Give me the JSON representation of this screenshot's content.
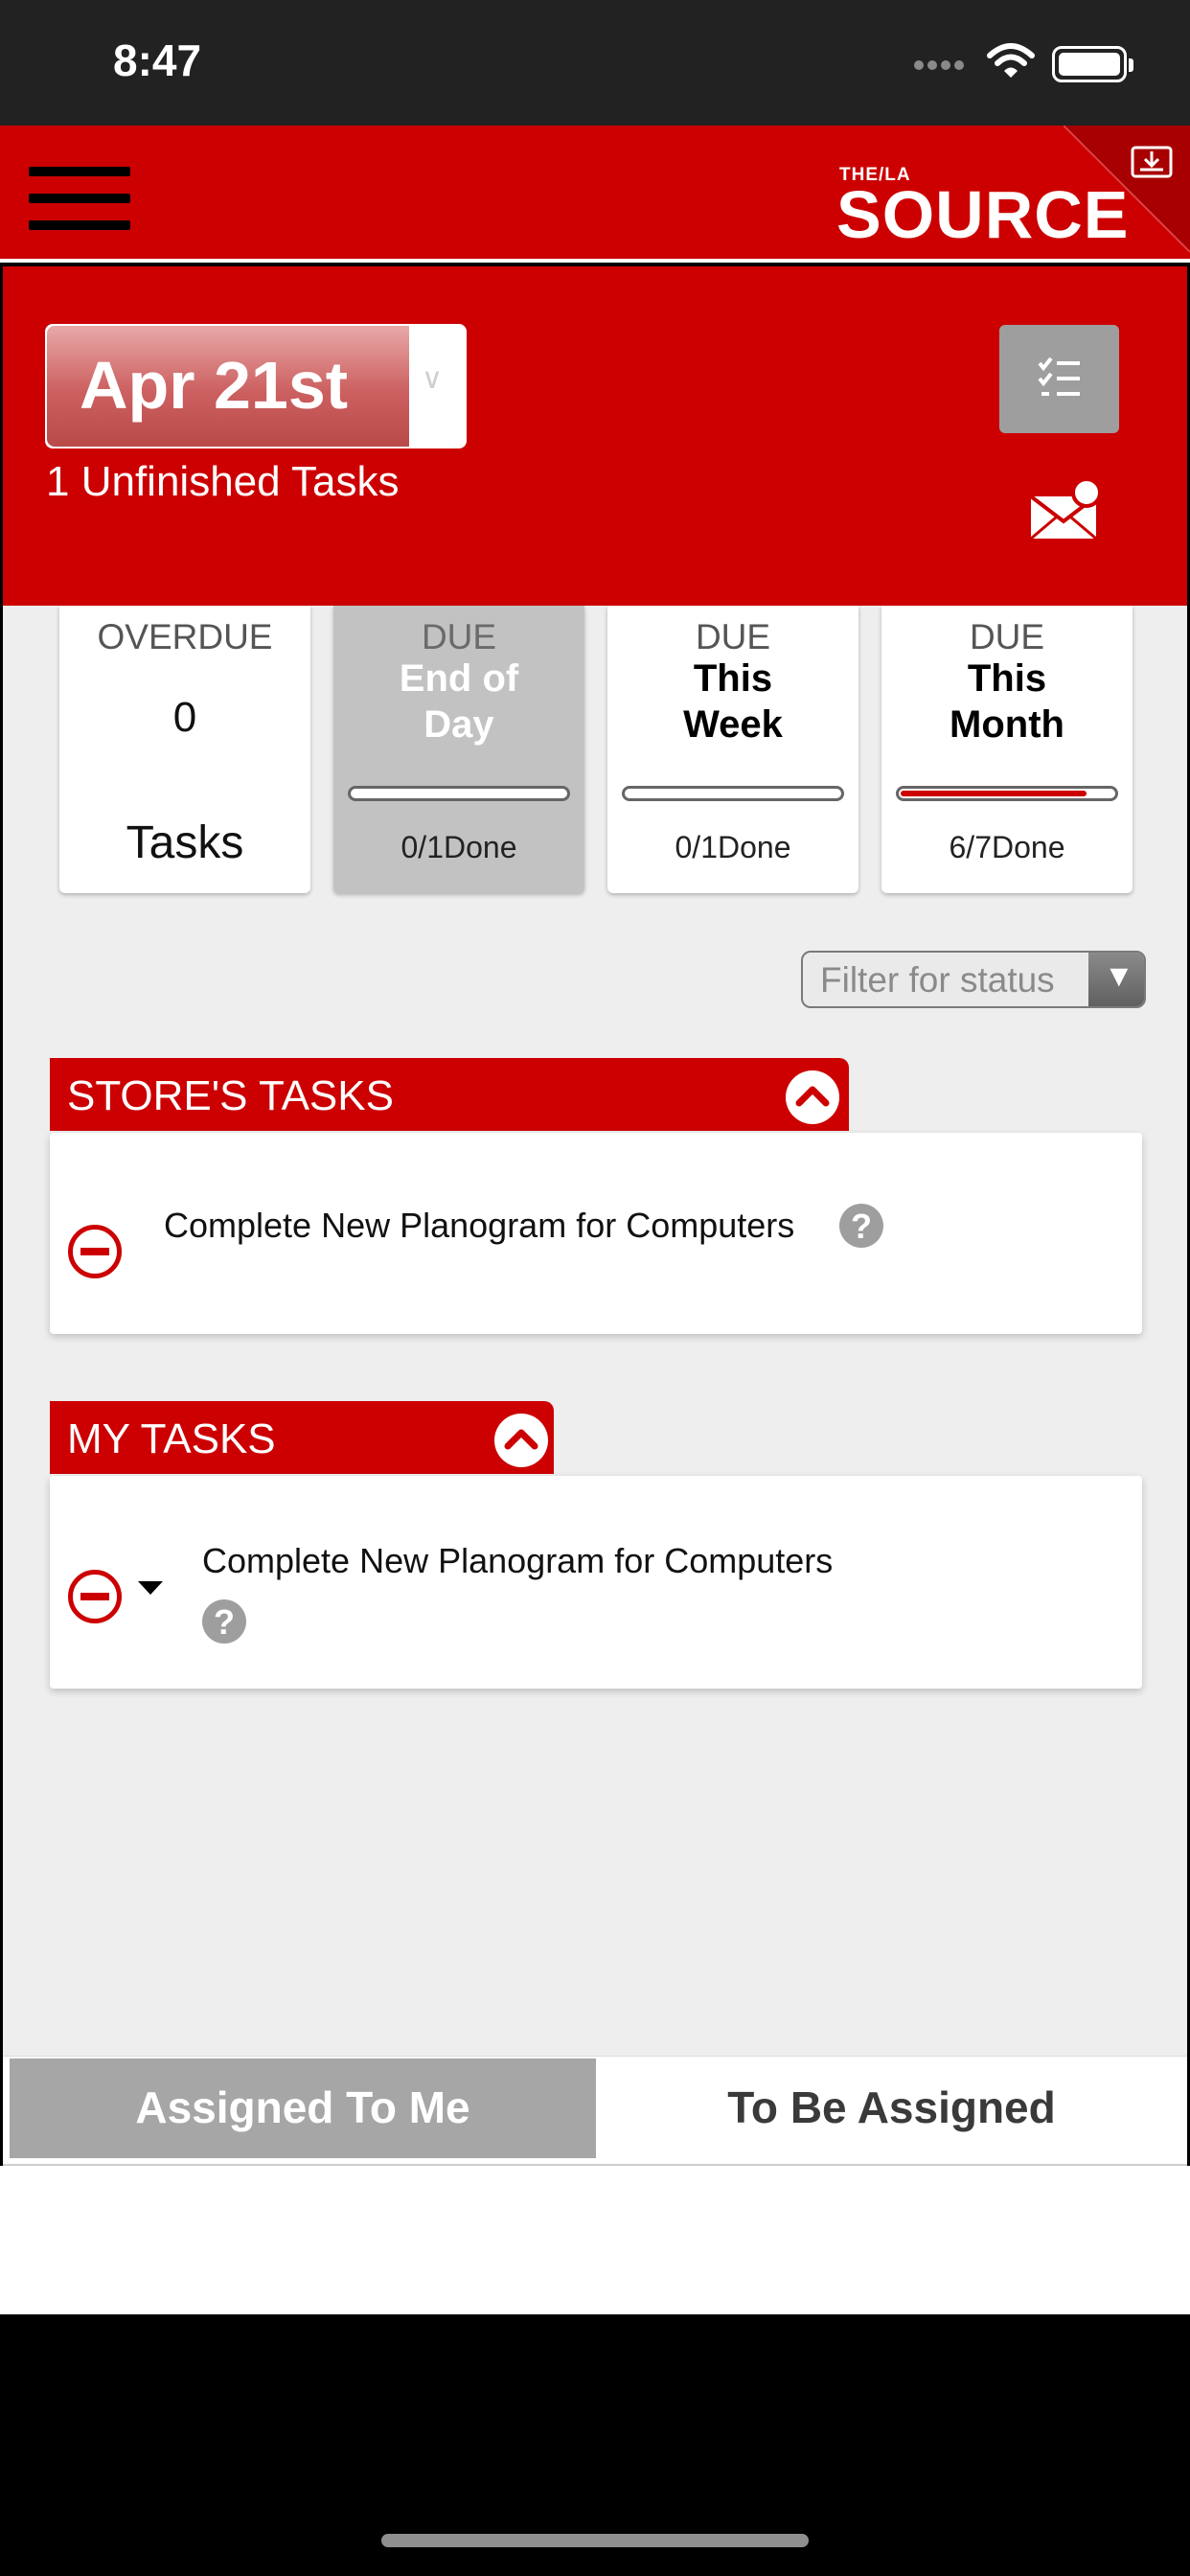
{
  "status_bar": {
    "time": "8:47"
  },
  "header": {
    "logo_small": "THE/LA",
    "logo_main": "SOURCE",
    "accent_color": "#cc0000"
  },
  "date_panel": {
    "date": "Apr 21st",
    "chevron": "∨",
    "unfinished": "1 Unfinished Tasks"
  },
  "cards": {
    "overdue": {
      "label": "OVERDUE",
      "count": "0",
      "unit": "Tasks"
    },
    "end_of_day": {
      "label": "DUE",
      "period": "End of Day",
      "done": "0/1Done",
      "progress": 0
    },
    "this_week": {
      "label": "DUE",
      "period": "This Week",
      "done": "0/1Done",
      "progress": 0
    },
    "this_month": {
      "label": "DUE",
      "period": "This Month",
      "done": "6/7Done",
      "progress": 0.857
    }
  },
  "filter": {
    "placeholder": "Filter for status",
    "arrow": "▼"
  },
  "stores_tasks": {
    "title": "STORE'S TASKS",
    "items": [
      {
        "text": "Complete New Planogram for Computers"
      }
    ]
  },
  "my_tasks": {
    "title": "MY TASKS",
    "items": [
      {
        "text": "Complete New Planogram for Computers"
      }
    ]
  },
  "help_glyph": "?",
  "tabs": {
    "assigned": "Assigned To Me",
    "unassigned": "To Be Assigned"
  }
}
